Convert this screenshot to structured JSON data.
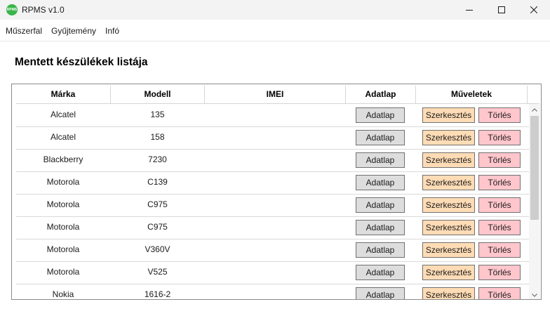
{
  "window": {
    "title": "RPMS v1.0",
    "logo_text": "RPMS",
    "accent_color": "#39b54a"
  },
  "menu": {
    "items": [
      "Műszerfal",
      "Gyűjtemény",
      "Infó"
    ]
  },
  "page": {
    "title": "Mentett készülékek listája"
  },
  "table": {
    "columns": [
      "Márka",
      "Modell",
      "IMEI",
      "Adatlap",
      "Műveletek"
    ],
    "rows": [
      {
        "brand": "Alcatel",
        "model": "135",
        "imei": ""
      },
      {
        "brand": "Alcatel",
        "model": "158",
        "imei": ""
      },
      {
        "brand": "Blackberry",
        "model": "7230",
        "imei": ""
      },
      {
        "brand": "Motorola",
        "model": "C139",
        "imei": ""
      },
      {
        "brand": "Motorola",
        "model": "C975",
        "imei": ""
      },
      {
        "brand": "Motorola",
        "model": "C975",
        "imei": ""
      },
      {
        "brand": "Motorola",
        "model": "V360V",
        "imei": ""
      },
      {
        "brand": "Motorola",
        "model": "V525",
        "imei": ""
      },
      {
        "brand": "Nokia",
        "model": "1616-2",
        "imei": ""
      }
    ],
    "buttons": {
      "details": "Adatlap",
      "edit": "Szerkesztés",
      "delete": "Törlés"
    },
    "button_colors": {
      "details": "#dddddd",
      "edit": "#ffdcb5",
      "delete": "#ffc6cc"
    }
  }
}
